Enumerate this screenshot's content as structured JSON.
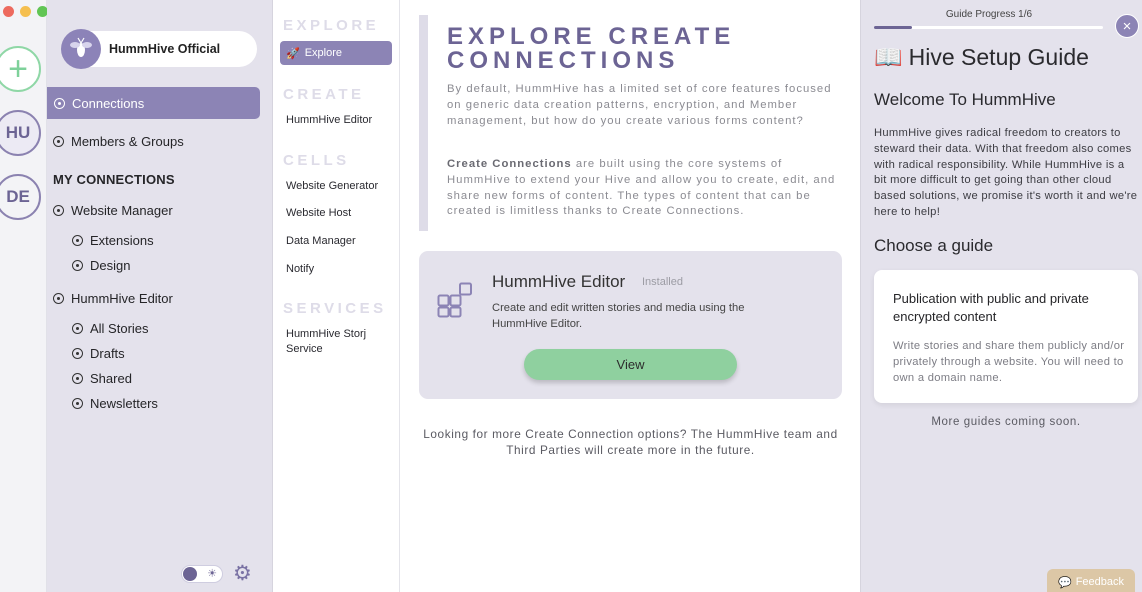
{
  "rail": {
    "add_label": "+",
    "spaces": [
      {
        "initials": "HU"
      },
      {
        "initials": "DE"
      }
    ]
  },
  "sidebar": {
    "hive_name": "HummHive Official",
    "items": [
      {
        "label": "Connections"
      },
      {
        "label": "Members & Groups"
      }
    ],
    "my_connections_heading": "MY CONNECTIONS",
    "website_manager": {
      "label": "Website Manager",
      "children": [
        {
          "label": "Extensions"
        },
        {
          "label": "Design"
        }
      ]
    },
    "hummhive_editor": {
      "label": "HummHive Editor",
      "children": [
        {
          "label": "All Stories"
        },
        {
          "label": "Drafts"
        },
        {
          "label": "Shared"
        },
        {
          "label": "Newsletters"
        }
      ]
    }
  },
  "explore_nav": {
    "explore_heading": "EXPLORE",
    "explore_button": "Explore",
    "create_heading": "CREATE",
    "create_links": [
      {
        "label": "HummHive Editor"
      }
    ],
    "cells_heading": "CELLS",
    "cells_links": [
      {
        "label": "Website Generator"
      },
      {
        "label": "Website Host"
      },
      {
        "label": "Data Manager"
      },
      {
        "label": "Notify"
      }
    ],
    "services_heading": "SERVICES",
    "services_links": [
      {
        "label": "HummHive Storj Service"
      }
    ]
  },
  "main": {
    "title": "EXPLORE CREATE CONNECTIONS",
    "intro": "By default, HummHive has a limited set of core features focused on generic data creation patterns, encryption, and Member management, but how do you create various forms content?",
    "body_strong": "Create Connections",
    "body_rest": " are built using the core systems of HummHive to extend your Hive and allow you to create, edit, and share new forms of content. The types of content that can be created is limitless thanks to Create Connections.",
    "card": {
      "title": "HummHive Editor",
      "badge": "Installed",
      "description": "Create and edit written stories and media using the HummHive Editor.",
      "button": "View"
    },
    "more_note": "Looking for more Create Connection options? The HummHive team and Third Parties will create more in the future."
  },
  "guide": {
    "progress_label": "Guide Progress 1/6",
    "progress_fraction": 0.1667,
    "close_icon": "×",
    "book_icon": "📖",
    "title": "Hive Setup Guide",
    "welcome": "Welcome To HummHive",
    "intro": "HummHive gives radical freedom to creators to steward their data. With that freedom also comes with radical responsibility. While HummHive is a bit more difficult to get going than other cloud based solutions, we promise it's worth it and we're here to help!",
    "choose_heading": "Choose a guide",
    "card_title": "Publication with public and private encrypted content",
    "card_desc": "Write stories and share them publicly and/or privately through a website. You will need to own a domain name.",
    "more": "More guides coming soon.",
    "feedback": "Feedback"
  },
  "colors": {
    "accent": "#8c84b5",
    "accent_dark": "#6c6494",
    "panel": "#e4e2ec",
    "view_button": "#8fd09f"
  }
}
